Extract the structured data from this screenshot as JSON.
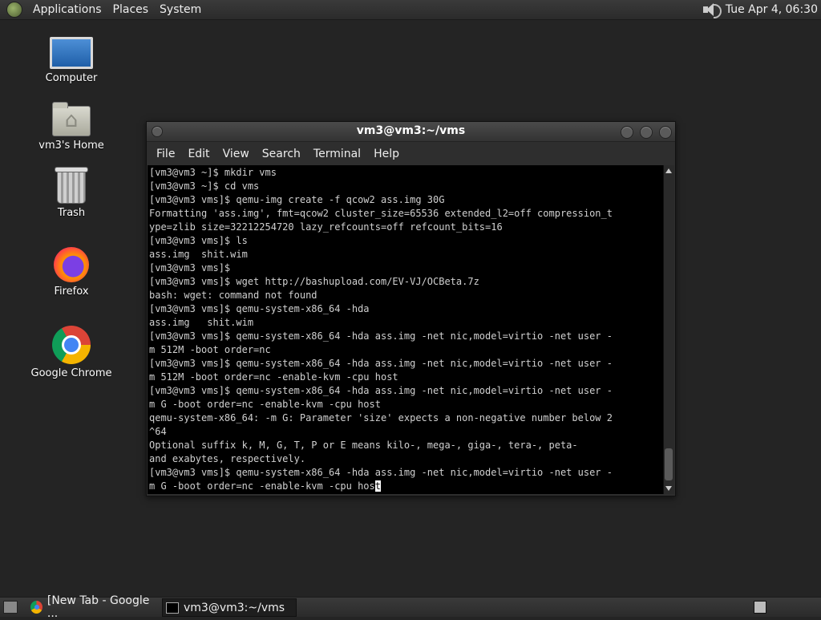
{
  "top_panel": {
    "menus": [
      "Applications",
      "Places",
      "System"
    ],
    "clock": "Tue Apr  4, 06:30"
  },
  "desktop_icons": {
    "computer": "Computer",
    "home": "vm3's Home",
    "trash": "Trash",
    "firefox": "Firefox",
    "chrome": "Google Chrome"
  },
  "terminal": {
    "title": "vm3@vm3:~/vms",
    "menu": [
      "File",
      "Edit",
      "View",
      "Search",
      "Terminal",
      "Help"
    ],
    "lines": [
      "[vm3@vm3 ~]$ mkdir vms",
      "[vm3@vm3 ~]$ cd vms",
      "[vm3@vm3 vms]$ qemu-img create -f qcow2 ass.img 30G",
      "Formatting 'ass.img', fmt=qcow2 cluster_size=65536 extended_l2=off compression_t",
      "ype=zlib size=32212254720 lazy_refcounts=off refcount_bits=16",
      "[vm3@vm3 vms]$ ls",
      "ass.img  shit.wim",
      "[vm3@vm3 vms]$",
      "[vm3@vm3 vms]$ wget http://bashupload.com/EV-VJ/OCBeta.7z",
      "bash: wget: command not found",
      "[vm3@vm3 vms]$ qemu-system-x86_64 -hda",
      "ass.img   shit.wim",
      "[vm3@vm3 vms]$ qemu-system-x86_64 -hda ass.img -net nic,model=virtio -net user -",
      "m 512M -boot order=nc",
      "[vm3@vm3 vms]$ qemu-system-x86_64 -hda ass.img -net nic,model=virtio -net user -",
      "m 512M -boot order=nc -enable-kvm -cpu host",
      "[vm3@vm3 vms]$ qemu-system-x86_64 -hda ass.img -net nic,model=virtio -net user -",
      "m G -boot order=nc -enable-kvm -cpu host",
      "qemu-system-x86_64: -m G: Parameter 'size' expects a non-negative number below 2",
      "^64",
      "Optional suffix k, M, G, T, P or E means kilo-, mega-, giga-, tera-, peta-",
      "and exabytes, respectively.",
      "[vm3@vm3 vms]$ qemu-system-x86_64 -hda ass.img -net nic,model=virtio -net user -"
    ],
    "current_line_before_cursor": "m G -boot order=nc -enable-kvm -cpu hos",
    "cursor_char": "t"
  },
  "taskbar": {
    "items": [
      "[New Tab - Google ...",
      "vm3@vm3:~/vms"
    ]
  }
}
